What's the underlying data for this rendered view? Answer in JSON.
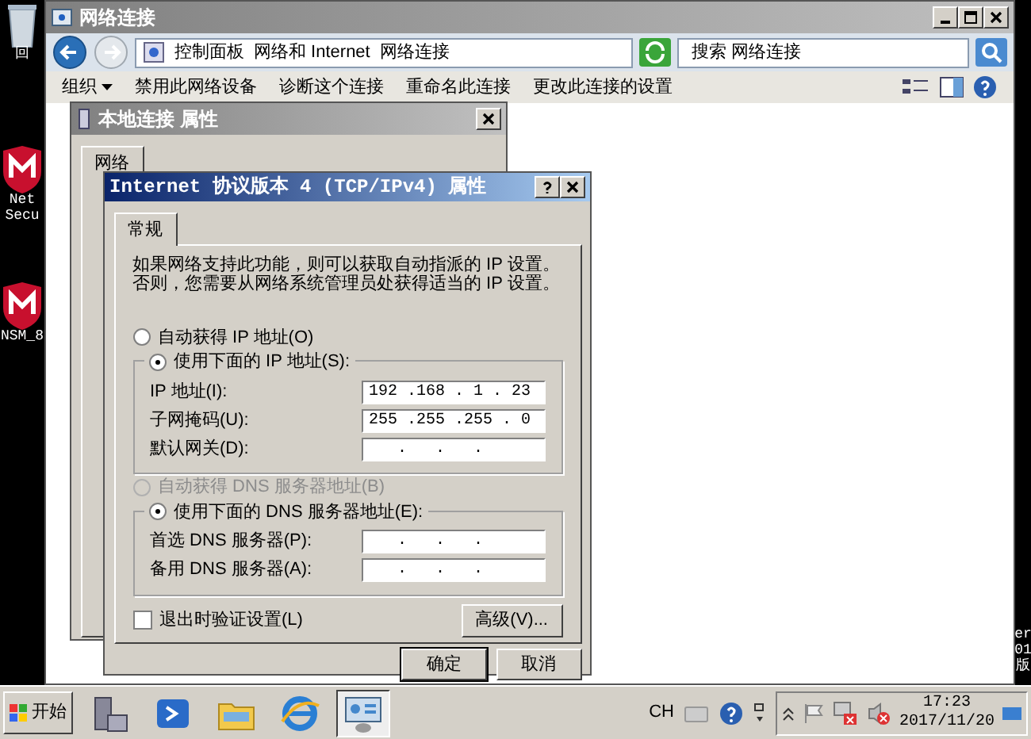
{
  "desktop": {
    "icons": [
      {
        "lines": [
          "回"
        ]
      },
      {
        "lines": [
          "Net",
          "Secu"
        ]
      },
      {
        "lines": [
          "NSM_8"
        ]
      }
    ],
    "edge_text": [
      "er",
      "01",
      "版"
    ]
  },
  "explorer": {
    "title": "网络连接",
    "breadcrumb": [
      "控制面板",
      "网络和 Internet",
      "网络连接"
    ],
    "search": {
      "placeholder": "搜索 网络连接"
    },
    "toolbar": [
      "组织",
      "禁用此网络设备",
      "诊断这个连接",
      "重命名此连接",
      "更改此连接的设置"
    ]
  },
  "properties_dialog": {
    "title": "本地连接 属性",
    "tabs": [
      {
        "label": "网络",
        "selected": true
      }
    ]
  },
  "ipv4_dialog": {
    "title": "Internet 协议版本 4 (TCP/IPv4) 属性",
    "tabs": [
      {
        "label": "常规",
        "selected": true
      }
    ],
    "description": "如果网络支持此功能，则可以获取自动指派的 IP 设置。否则，您需要从网络系统管理员处获得适当的 IP 设置。",
    "ip_mode": [
      {
        "label": "自动获得 IP 地址(O)",
        "selected": false
      },
      {
        "label": "使用下面的 IP 地址(S):",
        "selected": true
      }
    ],
    "ip_fields": [
      {
        "label": "IP 地址(I):",
        "value": "192 .168 . 1 . 23"
      },
      {
        "label": "子网掩码(U):",
        "value": "255 .255 .255 . 0"
      },
      {
        "label": "默认网关(D):",
        "value": "   .   .   ."
      }
    ],
    "dns_mode": [
      {
        "label": "自动获得 DNS 服务器地址(B)",
        "selected": false,
        "disabled": true
      },
      {
        "label": "使用下面的 DNS 服务器地址(E):",
        "selected": true,
        "disabled": false
      }
    ],
    "dns_fields": [
      {
        "label": "首选 DNS 服务器(P):",
        "value": "   .   .   ."
      },
      {
        "label": "备用 DNS 服务器(A):",
        "value": "   .   .   ."
      }
    ],
    "validate": {
      "label": "退出时验证设置(L)",
      "checked": false
    },
    "advanced_button": "高级(V)...",
    "buttons": [
      "确定",
      "取消"
    ]
  },
  "taskbar": {
    "start": "开始",
    "apps": [
      {
        "kind": "server",
        "selected": false
      },
      {
        "kind": "shell",
        "selected": false
      },
      {
        "kind": "folder",
        "selected": false
      },
      {
        "kind": "browser",
        "selected": false
      },
      {
        "kind": "network",
        "selected": true
      }
    ],
    "language": "CH",
    "time": "17:23",
    "date": "2017/11/20"
  }
}
